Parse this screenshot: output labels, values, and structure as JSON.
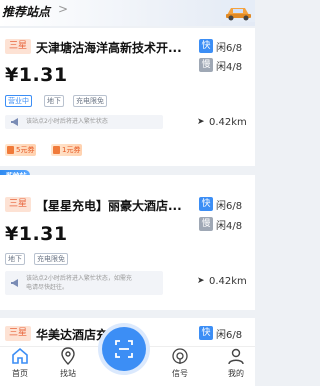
{
  "header": {
    "title": "推荐站点",
    "chevron": ">"
  },
  "promo_label": "苏地站",
  "stations": [
    {
      "star": "三星",
      "name": "天津塘沽海洋高新技术开...",
      "price": "¥1.31",
      "fast_label": "快",
      "fast_count": "闲6/8",
      "slow_label": "慢",
      "slow_count": "闲4/8",
      "tags": [
        "营业中",
        "地下",
        "充电限免"
      ],
      "notice": "该站点2小时后将进入繁忙状态",
      "distance": "0.42km",
      "coupons": [
        "5元券",
        "1元券"
      ]
    },
    {
      "star": "三星",
      "name": "【星星充电】丽豪大酒店...",
      "price": "¥1.31",
      "fast_label": "快",
      "fast_count": "闲6/8",
      "slow_label": "慢",
      "slow_count": "闲4/8",
      "tags": [
        "地下",
        "充电限免"
      ],
      "notice_line1": "该站点2小时后将进入繁忙状态，如需充",
      "notice_line2": "电请尽快赶往。",
      "distance": "0.42km"
    },
    {
      "star": "三星",
      "name": "华美达酒店充...",
      "fast_label": "快",
      "fast_count": "闲6/8"
    }
  ],
  "tabbar": [
    {
      "label": "首页",
      "icon": "home-icon"
    },
    {
      "label": "找站",
      "icon": "location-pin-icon"
    },
    {
      "label": "信号",
      "icon": "signal-icon"
    },
    {
      "label": "我的",
      "icon": "person-icon"
    }
  ],
  "colors": {
    "accent": "#3c8ef5",
    "coupon": "#e65a26",
    "star": "#e8643b"
  }
}
